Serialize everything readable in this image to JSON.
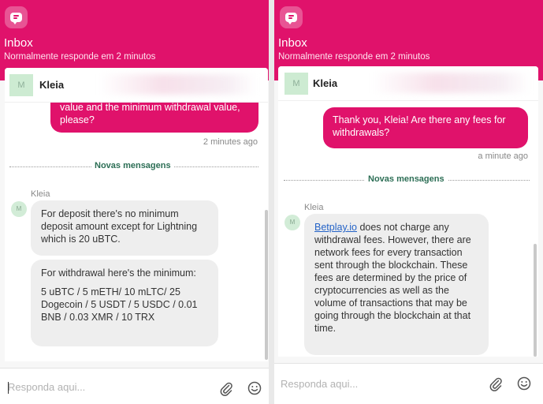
{
  "colors": {
    "brand": "#e0126b",
    "link": "#2463c7",
    "divider_label": "#2c6e55"
  },
  "left": {
    "header": {
      "title": "Inbox",
      "subtitle": "Normalmente responde em 2 minutos",
      "logo_icon": "chat-bubble-icon"
    },
    "agent": {
      "avatar": "M",
      "name": "Kleia"
    },
    "messages": {
      "outgoing_text": "value and the minimum withdrawal value, please?",
      "outgoing_time": "2 minutes ago",
      "divider": "Novas mensagens",
      "sender": "Kleia",
      "avatar": "M",
      "incoming_1": "For deposit there's no minimum deposit amount except for Lightning which is 20 uBTC.",
      "incoming_2_line1": "For withdrawal here's the minimum:",
      "incoming_2_line2": "5 uBTC / 5 mETH/ 10 mLTC/ 25 Dogecoin  / 5 USDT / 5 USDC / 0.01 BNB / 0.03 XMR / 10 TRX"
    },
    "composer": {
      "placeholder": "Responda aqui...",
      "attach_icon": "paperclip-icon",
      "emoji_icon": "smiley-icon"
    }
  },
  "right": {
    "header": {
      "title": "Inbox",
      "subtitle": "Normalmente responde em 2 minutos",
      "logo_icon": "chat-bubble-icon"
    },
    "agent": {
      "avatar": "M",
      "name": "Kleia"
    },
    "messages": {
      "outgoing_text": "Thank you, Kleia! Are there any fees for withdrawals?",
      "outgoing_time": "a minute ago",
      "divider": "Novas mensagens",
      "sender": "Kleia",
      "avatar": "M",
      "incoming_link": "Betplay.io",
      "incoming_rest": " does not charge any withdrawal fees. However, there are network fees for every transaction sent through the blockchain. These fees are determined by the price of cryptocurrencies as well as the volume of transactions that may be going through the blockchain at that time."
    },
    "composer": {
      "placeholder": "Responda aqui...",
      "attach_icon": "paperclip-icon",
      "emoji_icon": "smiley-icon"
    }
  }
}
